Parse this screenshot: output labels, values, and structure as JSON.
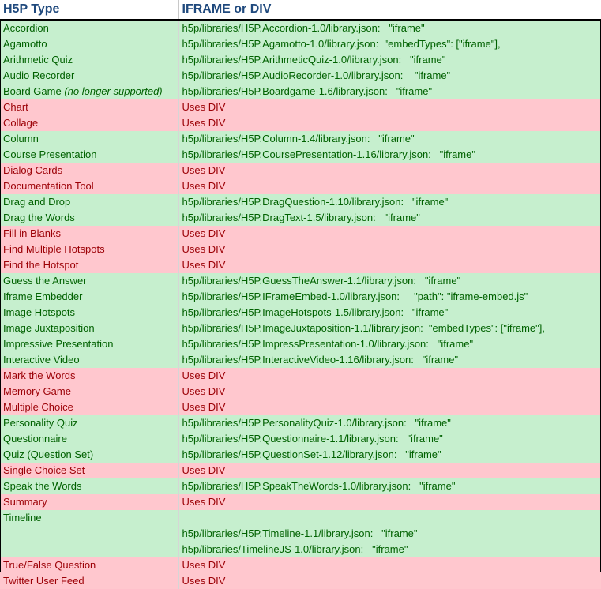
{
  "headers": {
    "type": "H5P Type",
    "embed": "IFRAME or DIV"
  },
  "colors": {
    "iframe_fill": "#c6efce",
    "iframe_text": "#006100",
    "div_fill": "#ffc7ce",
    "div_text": "#9c0006",
    "header_text": "#1f497d"
  },
  "rows": [
    {
      "type": "Accordion",
      "note": "",
      "embed": "h5p/libraries/H5P.Accordion-1.0/library.json:   \"iframe\"",
      "kind": "iframe"
    },
    {
      "type": "Agamotto",
      "note": "",
      "embed": "h5p/libraries/H5P.Agamotto-1.0/library.json:  \"embedTypes\": [\"iframe\"],",
      "kind": "iframe"
    },
    {
      "type": "Arithmetic Quiz",
      "note": "",
      "embed": "h5p/libraries/H5P.ArithmeticQuiz-1.0/library.json:   \"iframe\"",
      "kind": "iframe"
    },
    {
      "type": "Audio Recorder",
      "note": "",
      "embed": "h5p/libraries/H5P.AudioRecorder-1.0/library.json:    \"iframe\"",
      "kind": "iframe"
    },
    {
      "type": "Board Game ",
      "note": "(no longer supported)",
      "embed": "h5p/libraries/H5P.Boardgame-1.6/library.json:   \"iframe\"",
      "kind": "iframe"
    },
    {
      "type": "Chart",
      "note": "",
      "embed": "Uses DIV",
      "kind": "div"
    },
    {
      "type": "Collage",
      "note": "",
      "embed": "Uses DIV",
      "kind": "div"
    },
    {
      "type": "Column",
      "note": "",
      "embed": "h5p/libraries/H5P.Column-1.4/library.json:   \"iframe\"",
      "kind": "iframe"
    },
    {
      "type": "Course Presentation",
      "note": "",
      "embed": "h5p/libraries/H5P.CoursePresentation-1.16/library.json:   \"iframe\"",
      "kind": "iframe"
    },
    {
      "type": "Dialog Cards",
      "note": "",
      "embed": "Uses DIV",
      "kind": "div"
    },
    {
      "type": "Documentation Tool",
      "note": "",
      "embed": "Uses DIV",
      "kind": "div"
    },
    {
      "type": "Drag and Drop",
      "note": "",
      "embed": "h5p/libraries/H5P.DragQuestion-1.10/library.json:   \"iframe\"",
      "kind": "iframe"
    },
    {
      "type": "Drag the Words",
      "note": "",
      "embed": "h5p/libraries/H5P.DragText-1.5/library.json:   \"iframe\"",
      "kind": "iframe"
    },
    {
      "type": "Fill in Blanks",
      "note": "",
      "embed": "Uses DIV",
      "kind": "div"
    },
    {
      "type": "Find Multiple Hotspots",
      "note": "",
      "embed": "Uses DIV",
      "kind": "div"
    },
    {
      "type": "Find the Hotspot",
      "note": "",
      "embed": "Uses DIV",
      "kind": "div"
    },
    {
      "type": "Guess the Answer",
      "note": "",
      "embed": "h5p/libraries/H5P.GuessTheAnswer-1.1/library.json:   \"iframe\"",
      "kind": "iframe"
    },
    {
      "type": "Iframe Embedder",
      "note": "",
      "embed": "h5p/libraries/H5P.IFrameEmbed-1.0/library.json:     \"path\": \"iframe-embed.js\"",
      "kind": "iframe"
    },
    {
      "type": "Image Hotspots",
      "note": "",
      "embed": "h5p/libraries/H5P.ImageHotspots-1.5/library.json:   \"iframe\"",
      "kind": "iframe"
    },
    {
      "type": "Image Juxtaposition",
      "note": "",
      "embed": "h5p/libraries/H5P.ImageJuxtaposition-1.1/library.json:  \"embedTypes\": [\"iframe\"],",
      "kind": "iframe"
    },
    {
      "type": "Impressive Presentation",
      "note": "",
      "embed": "h5p/libraries/H5P.ImpressPresentation-1.0/library.json:   \"iframe\"",
      "kind": "iframe"
    },
    {
      "type": "Interactive Video",
      "note": "",
      "embed": "h5p/libraries/H5P.InteractiveVideo-1.16/library.json:   \"iframe\"",
      "kind": "iframe"
    },
    {
      "type": "Mark the Words",
      "note": "",
      "embed": "Uses DIV",
      "kind": "div"
    },
    {
      "type": "Memory Game",
      "note": "",
      "embed": "Uses DIV",
      "kind": "div"
    },
    {
      "type": "Multiple Choice",
      "note": "",
      "embed": "Uses DIV",
      "kind": "div"
    },
    {
      "type": "Personality Quiz",
      "note": "",
      "embed": "h5p/libraries/H5P.PersonalityQuiz-1.0/library.json:   \"iframe\"",
      "kind": "iframe"
    },
    {
      "type": "Questionnaire",
      "note": "",
      "embed": "h5p/libraries/H5P.Questionnaire-1.1/library.json:   \"iframe\"",
      "kind": "iframe"
    },
    {
      "type": "Quiz (Question Set)",
      "note": "",
      "embed": "h5p/libraries/H5P.QuestionSet-1.12/library.json:   \"iframe\"",
      "kind": "iframe"
    },
    {
      "type": "Single Choice Set",
      "note": "",
      "embed": "Uses DIV",
      "kind": "div"
    },
    {
      "type": "Speak the Words",
      "note": "",
      "embed": "h5p/libraries/H5P.SpeakTheWords-1.0/library.json:   \"iframe\"",
      "kind": "iframe"
    },
    {
      "type": "Summary",
      "note": "",
      "embed": "Uses DIV",
      "kind": "div"
    },
    {
      "type": "Timeline",
      "note": "",
      "embed": "",
      "kind": "iframe"
    },
    {
      "type": "",
      "note": "",
      "embed": "h5p/libraries/H5P.Timeline-1.1/library.json:   \"iframe\"",
      "kind": "iframe"
    },
    {
      "type": "",
      "note": "",
      "embed": "h5p/libraries/TimelineJS-1.0/library.json:   \"iframe\"",
      "kind": "iframe"
    },
    {
      "type": "True/False Question",
      "note": "",
      "embed": "Uses DIV",
      "kind": "div"
    },
    {
      "type": "Twitter User Feed",
      "note": "",
      "embed": "Uses DIV",
      "kind": "div"
    }
  ]
}
